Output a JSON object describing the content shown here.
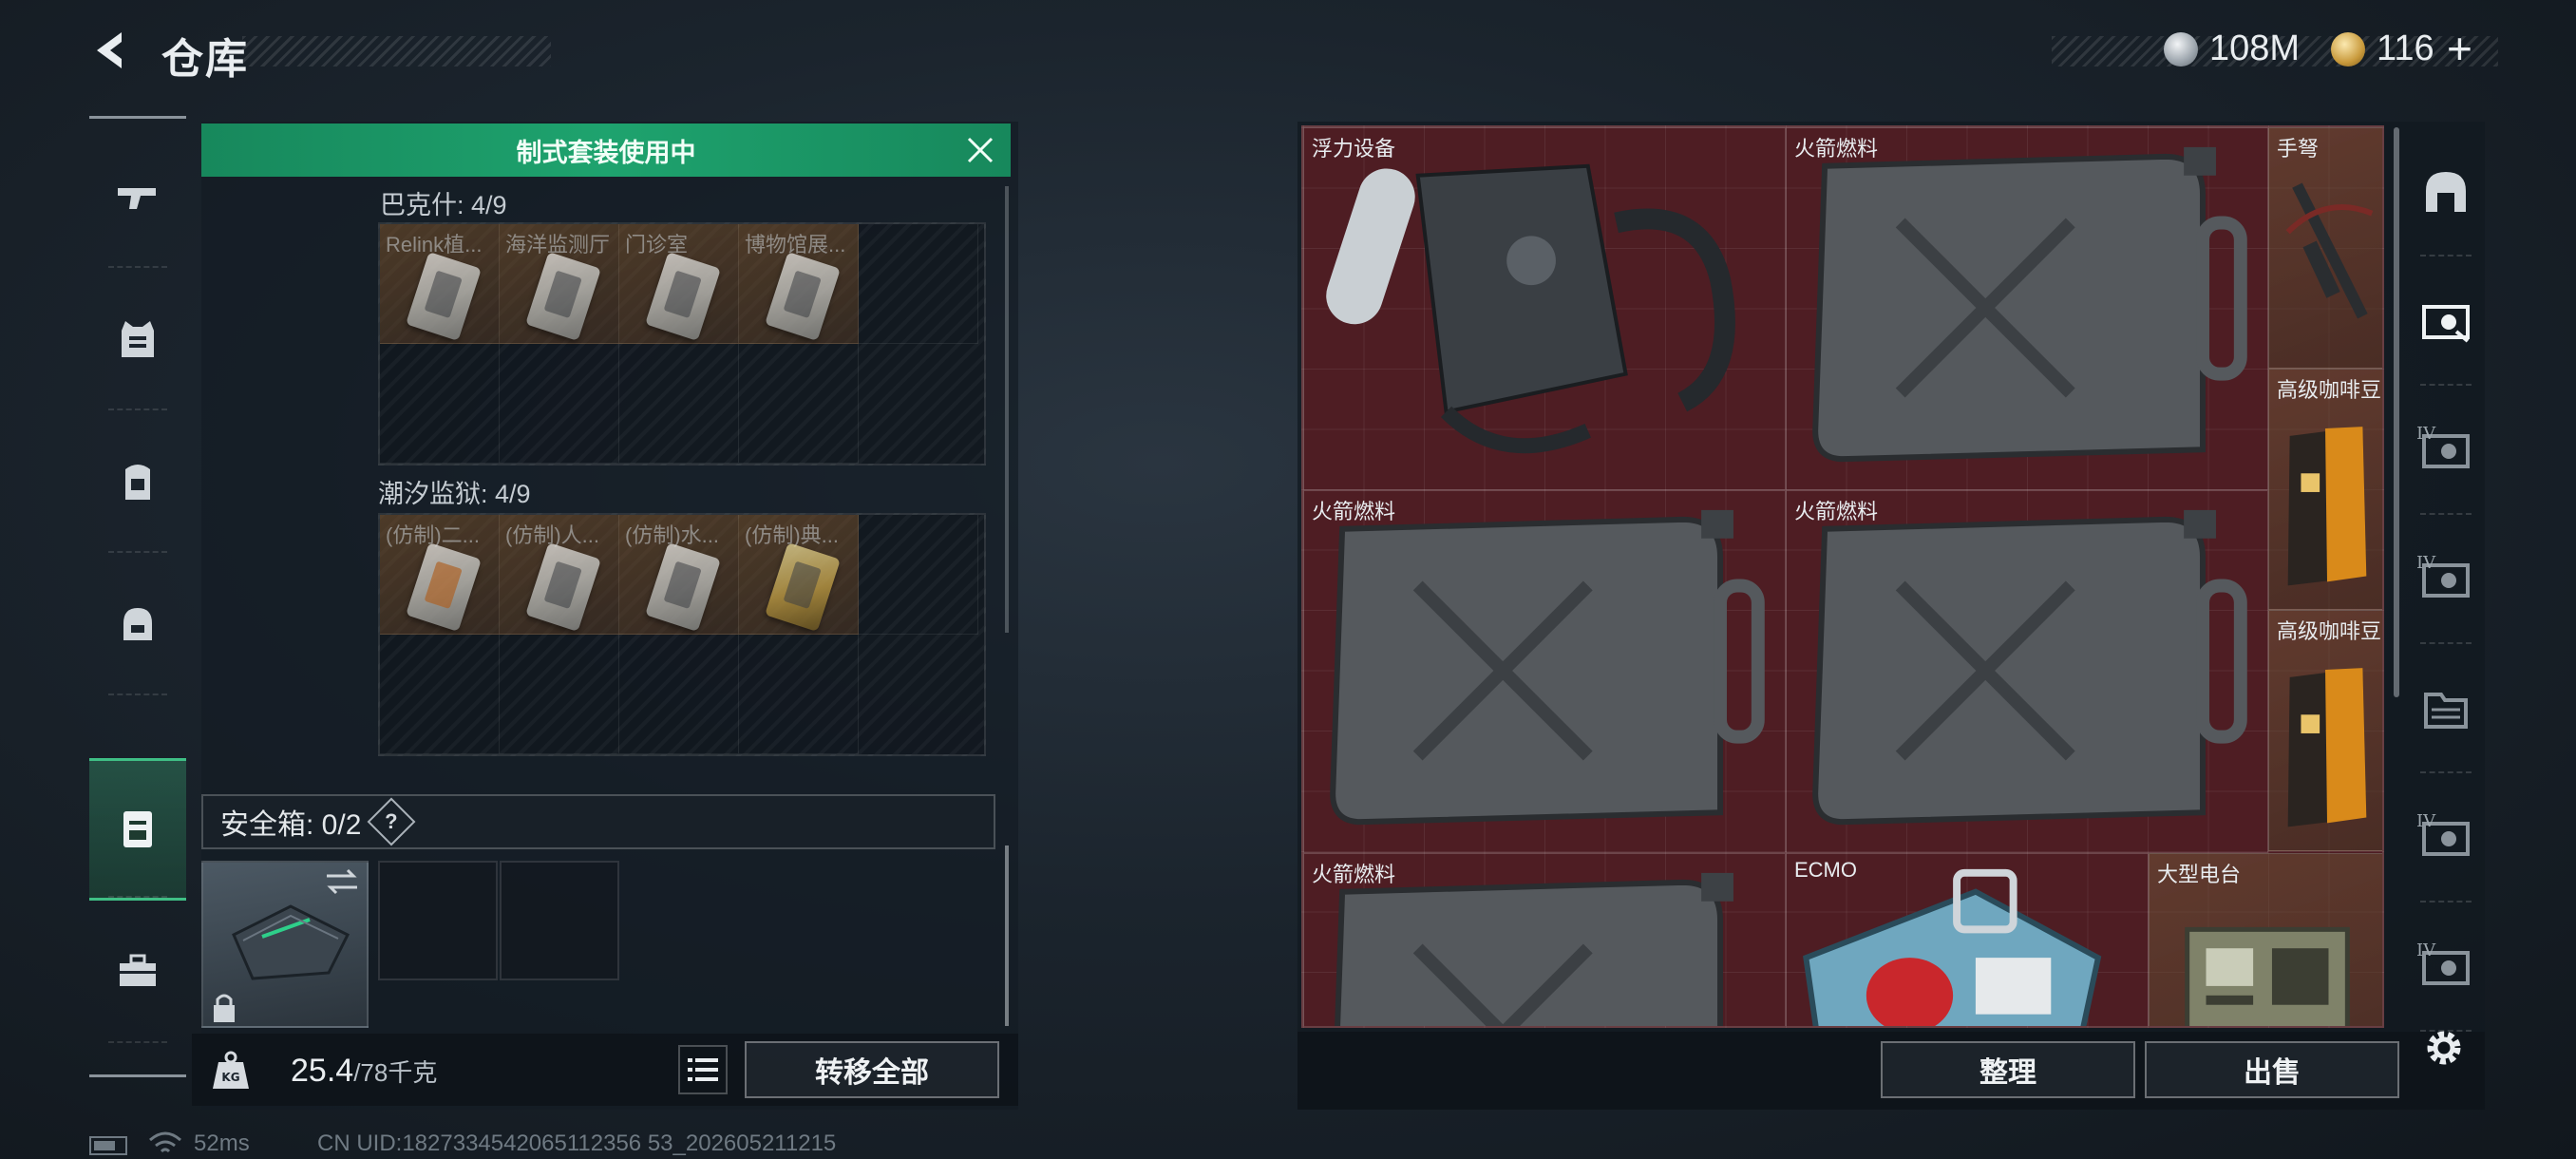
{
  "header": {
    "title": "仓库"
  },
  "currency": {
    "silver": "108M",
    "gold": "116",
    "plus": "+"
  },
  "sidebar": {
    "items": [
      {
        "icon": "gun-icon"
      },
      {
        "icon": "armor-vest-icon"
      },
      {
        "icon": "backpack-icon"
      },
      {
        "icon": "helmet-bag-icon"
      },
      {
        "icon": "safe-case-icon",
        "active": true
      },
      {
        "icon": "toolbox-icon"
      }
    ]
  },
  "left_panel": {
    "banner": "制式套装使用中",
    "sections": [
      {
        "label": "巴克什: 4/9",
        "slots": [
          "Relink植...",
          "海洋监测厅",
          "门诊室",
          "博物馆展..."
        ]
      },
      {
        "label": "潮汐监狱: 4/9",
        "slots": [
          "(仿制)二...",
          "(仿制)人...",
          "(仿制)水...",
          "(仿制)典..."
        ]
      }
    ],
    "safe_box": {
      "label": "安全箱: 0/2",
      "help": "?"
    },
    "weight": {
      "current": "25.4",
      "max": "/78千克"
    },
    "transfer_label": "转移全部"
  },
  "warehouse": {
    "items": [
      {
        "name": "浮力设备"
      },
      {
        "name": "火箭燃料"
      },
      {
        "name": "手弩"
      },
      {
        "name": "高级咖啡豆"
      },
      {
        "name": "火箭燃料"
      },
      {
        "name": "火箭燃料"
      },
      {
        "name": "高级咖啡豆"
      },
      {
        "name": "火箭燃料"
      },
      {
        "name": "ECMO"
      },
      {
        "name": "大型电台"
      }
    ],
    "sort_label": "整理",
    "sell_label": "出售"
  },
  "tabs": {
    "tiers": [
      "IV",
      "IV",
      "IV",
      "IV"
    ]
  },
  "status": {
    "ping": "52ms",
    "uid": "CN UID:1827334542065112356 53_202605211215"
  },
  "colors": {
    "accent_green": "#1ea36e",
    "grid_red": "#4e1d23"
  }
}
